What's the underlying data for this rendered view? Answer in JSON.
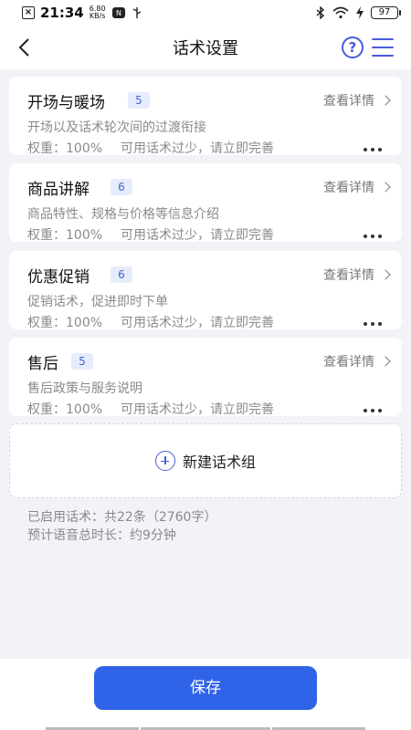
{
  "status_bar": {
    "time": "21:34",
    "speed_value": "6.80",
    "speed_unit": "KB/s",
    "battery": "97"
  },
  "nav": {
    "title": "话术设置",
    "help_glyph": "?"
  },
  "cards": [
    {
      "title": "开场与暖场",
      "count": "5",
      "detail": "查看详情",
      "desc": "开场以及话术轮次间的过渡衔接",
      "weight": "权重：100%",
      "warning": "可用话术过少，请立即完善"
    },
    {
      "title": "商品讲解",
      "count": "6",
      "detail": "查看详情",
      "desc": "商品特性、规格与价格等信息介绍",
      "weight": "权重：100%",
      "warning": "可用话术过少，请立即完善"
    },
    {
      "title": "优惠促销",
      "count": "6",
      "detail": "查看详情",
      "desc": "促销话术，促进即时下单",
      "weight": "权重：100%",
      "warning": "可用话术过少，请立即完善"
    },
    {
      "title": "售后",
      "count": "5",
      "detail": "查看详情",
      "desc": "售后政策与服务说明",
      "weight": "权重：100%",
      "warning": "可用话术过少，请立即完善"
    }
  ],
  "new_group_label": "新建话术组",
  "summary": {
    "enabled": "已启用话术：共22条（2760字）",
    "duration": "预计语音总时长：约9分钟"
  },
  "save_label": "保存",
  "colors": {
    "accent": "#2f63e8",
    "icon_blue": "#4a5bd8",
    "badge_bg": "#e6ecfb",
    "page_bg": "#f2f3f7"
  }
}
